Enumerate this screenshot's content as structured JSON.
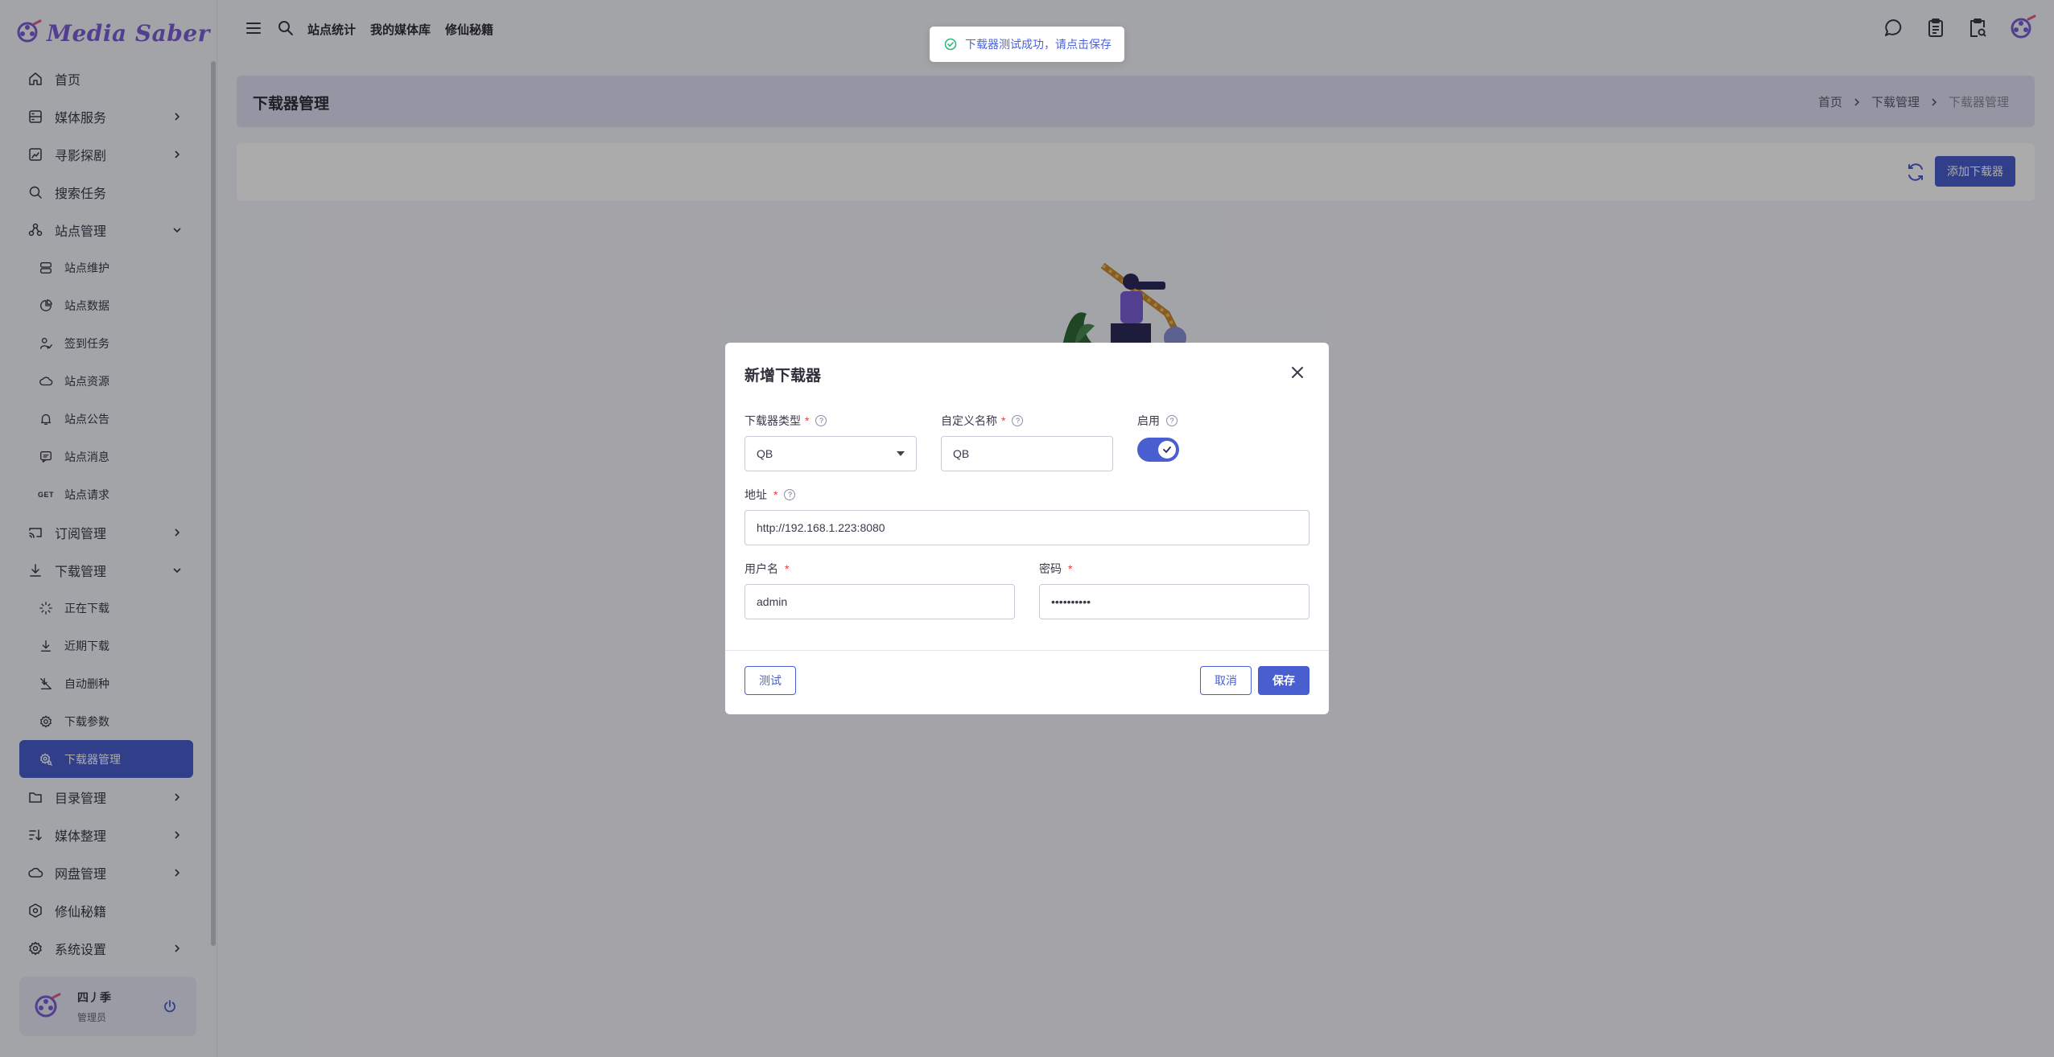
{
  "brand": {
    "name": "Media Saber"
  },
  "colors": {
    "primary": "#4a5fcf",
    "brand": "#7b5fd6",
    "success": "#2db87d",
    "required": "#e53e3e"
  },
  "sidebar": {
    "items": [
      {
        "label": "首页",
        "icon": "home-icon",
        "level": 0
      },
      {
        "label": "媒体服务",
        "icon": "server-icon",
        "level": 0,
        "expandable": true
      },
      {
        "label": "寻影探剧",
        "icon": "image-icon",
        "level": 0,
        "expandable": true
      },
      {
        "label": "搜索任务",
        "icon": "search-icon",
        "level": 0
      },
      {
        "label": "站点管理",
        "icon": "sites-icon",
        "level": 0,
        "expanded": true
      },
      {
        "label": "站点维护",
        "icon": "database-icon",
        "level": 1
      },
      {
        "label": "站点数据",
        "icon": "pie-chart-icon",
        "level": 1
      },
      {
        "label": "签到任务",
        "icon": "user-check-icon",
        "level": 1
      },
      {
        "label": "站点资源",
        "icon": "cloud-icon",
        "level": 1
      },
      {
        "label": "站点公告",
        "icon": "bell-icon",
        "level": 1
      },
      {
        "label": "站点消息",
        "icon": "message-icon",
        "level": 1
      },
      {
        "label": "站点请求",
        "icon": "get-icon",
        "level": 1,
        "badge": "GET"
      },
      {
        "label": "订阅管理",
        "icon": "cast-icon",
        "level": 0,
        "expandable": true
      },
      {
        "label": "下载管理",
        "icon": "download-icon",
        "level": 0,
        "expanded": true
      },
      {
        "label": "正在下载",
        "icon": "loader-icon",
        "level": 1
      },
      {
        "label": "近期下载",
        "icon": "download-icon",
        "level": 1
      },
      {
        "label": "自动删种",
        "icon": "download-off-icon",
        "level": 1
      },
      {
        "label": "下载参数",
        "icon": "gear-icon",
        "level": 1
      },
      {
        "label": "下载器管理",
        "icon": "gear-search-icon",
        "level": 1,
        "active": true
      },
      {
        "label": "目录管理",
        "icon": "folder-icon",
        "level": 0,
        "expandable": true
      },
      {
        "label": "媒体整理",
        "icon": "sort-icon",
        "level": 0,
        "expandable": true
      },
      {
        "label": "网盘管理",
        "icon": "cloud-icon",
        "level": 0,
        "expandable": true
      },
      {
        "label": "修仙秘籍",
        "icon": "hexagon-icon",
        "level": 0
      },
      {
        "label": "系统设置",
        "icon": "gear-icon",
        "level": 0,
        "expandable": true
      }
    ],
    "user": {
      "name": "四丿季",
      "role": "管理员"
    }
  },
  "topbar": {
    "links": [
      "站点统计",
      "我的媒体库",
      "修仙秘籍"
    ]
  },
  "page": {
    "title": "下载器管理",
    "breadcrumbs": [
      "首页",
      "下载管理",
      "下载器管理"
    ],
    "add_button": "添加下载器"
  },
  "toast": {
    "message": "下载器测试成功，请点击保存"
  },
  "dialog": {
    "title": "新增下载器",
    "fields": {
      "type": {
        "label": "下载器类型",
        "value": "QB"
      },
      "name": {
        "label": "自定义名称",
        "value": "QB"
      },
      "enabled": {
        "label": "启用",
        "value": true
      },
      "address": {
        "label": "地址",
        "value": "http://192.168.1.223:8080"
      },
      "username": {
        "label": "用户名",
        "value": "admin"
      },
      "password": {
        "label": "密码",
        "value": "••••••••••"
      }
    },
    "buttons": {
      "test": "测试",
      "cancel": "取消",
      "save": "保存"
    }
  }
}
